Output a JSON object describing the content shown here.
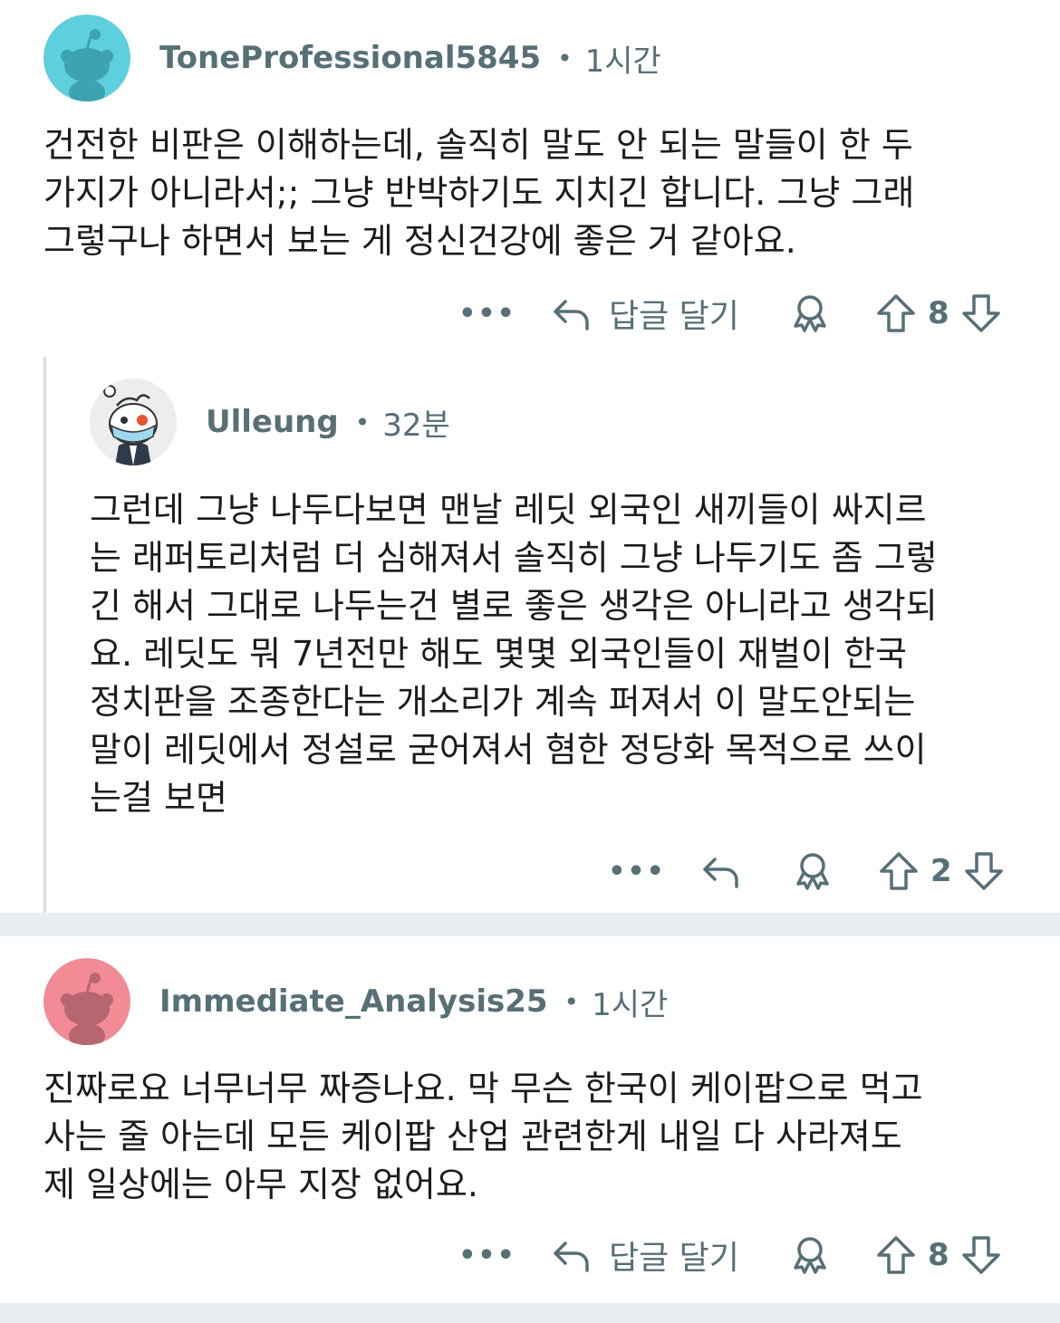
{
  "comments": [
    {
      "username": "ToneProfessional5845",
      "dot": "•",
      "time": "1시간",
      "avatar_color": "#5ecfdd",
      "lines": [
        "건전한 비판은 이해하는데, 솔직히 말도 안 되는 말들이 한 두",
        "가지가 아니라서;; 그냥 반박하기도 지치긴 합니다. 그냥 그래",
        "그렇구나 하면서 보는 게 정신건강에 좋은 거 같아요."
      ],
      "more": "•••",
      "reply_label": "답글 달기",
      "score": "8",
      "icons": [
        "more-icon",
        "reply-arrow-icon",
        "award-icon",
        "upvote-icon",
        "downvote-icon"
      ]
    },
    {
      "username": "Ulleung",
      "dot": "•",
      "time": "32분",
      "lines": [
        "그런데 그냥 나두다보면 맨날 레딧 외국인 새끼들이 싸지르",
        "는 래퍼토리처럼 더 심해져서 솔직히 그냥 나두기도 좀 그렇",
        "긴 해서 그대로 나두는건 별로 좋은 생각은 아니라고 생각되",
        "요. 레딧도 뭐 7년전만 해도 몇몇 외국인들이 재벌이 한국",
        "정치판을 조종한다는 개소리가 계속 퍼져서 이 말도안되는",
        "말이 레딧에서 정설로 굳어져서 혐한 정당화 목적으로 쓰이",
        "는걸 보면"
      ],
      "more": "•••",
      "score": "2"
    },
    {
      "username": "Immediate_Analysis25",
      "dot": "•",
      "time": "1시간",
      "avatar_color": "#f28b96",
      "lines": [
        "진짜로요 너무너무 짜증나요. 막 무슨 한국이 케이팝으로 먹고",
        "사는 줄 아는데 모든 케이팝 산업 관련한게 내일 다 사라져도",
        "제 일상에는 아무 지장 없어요."
      ],
      "more": "•••",
      "reply_label": "답글 달기",
      "score": "8"
    }
  ],
  "colors": {
    "meta_text": "#576f76",
    "separator": "#eaedef",
    "thread_line": "#d6dcdf"
  }
}
